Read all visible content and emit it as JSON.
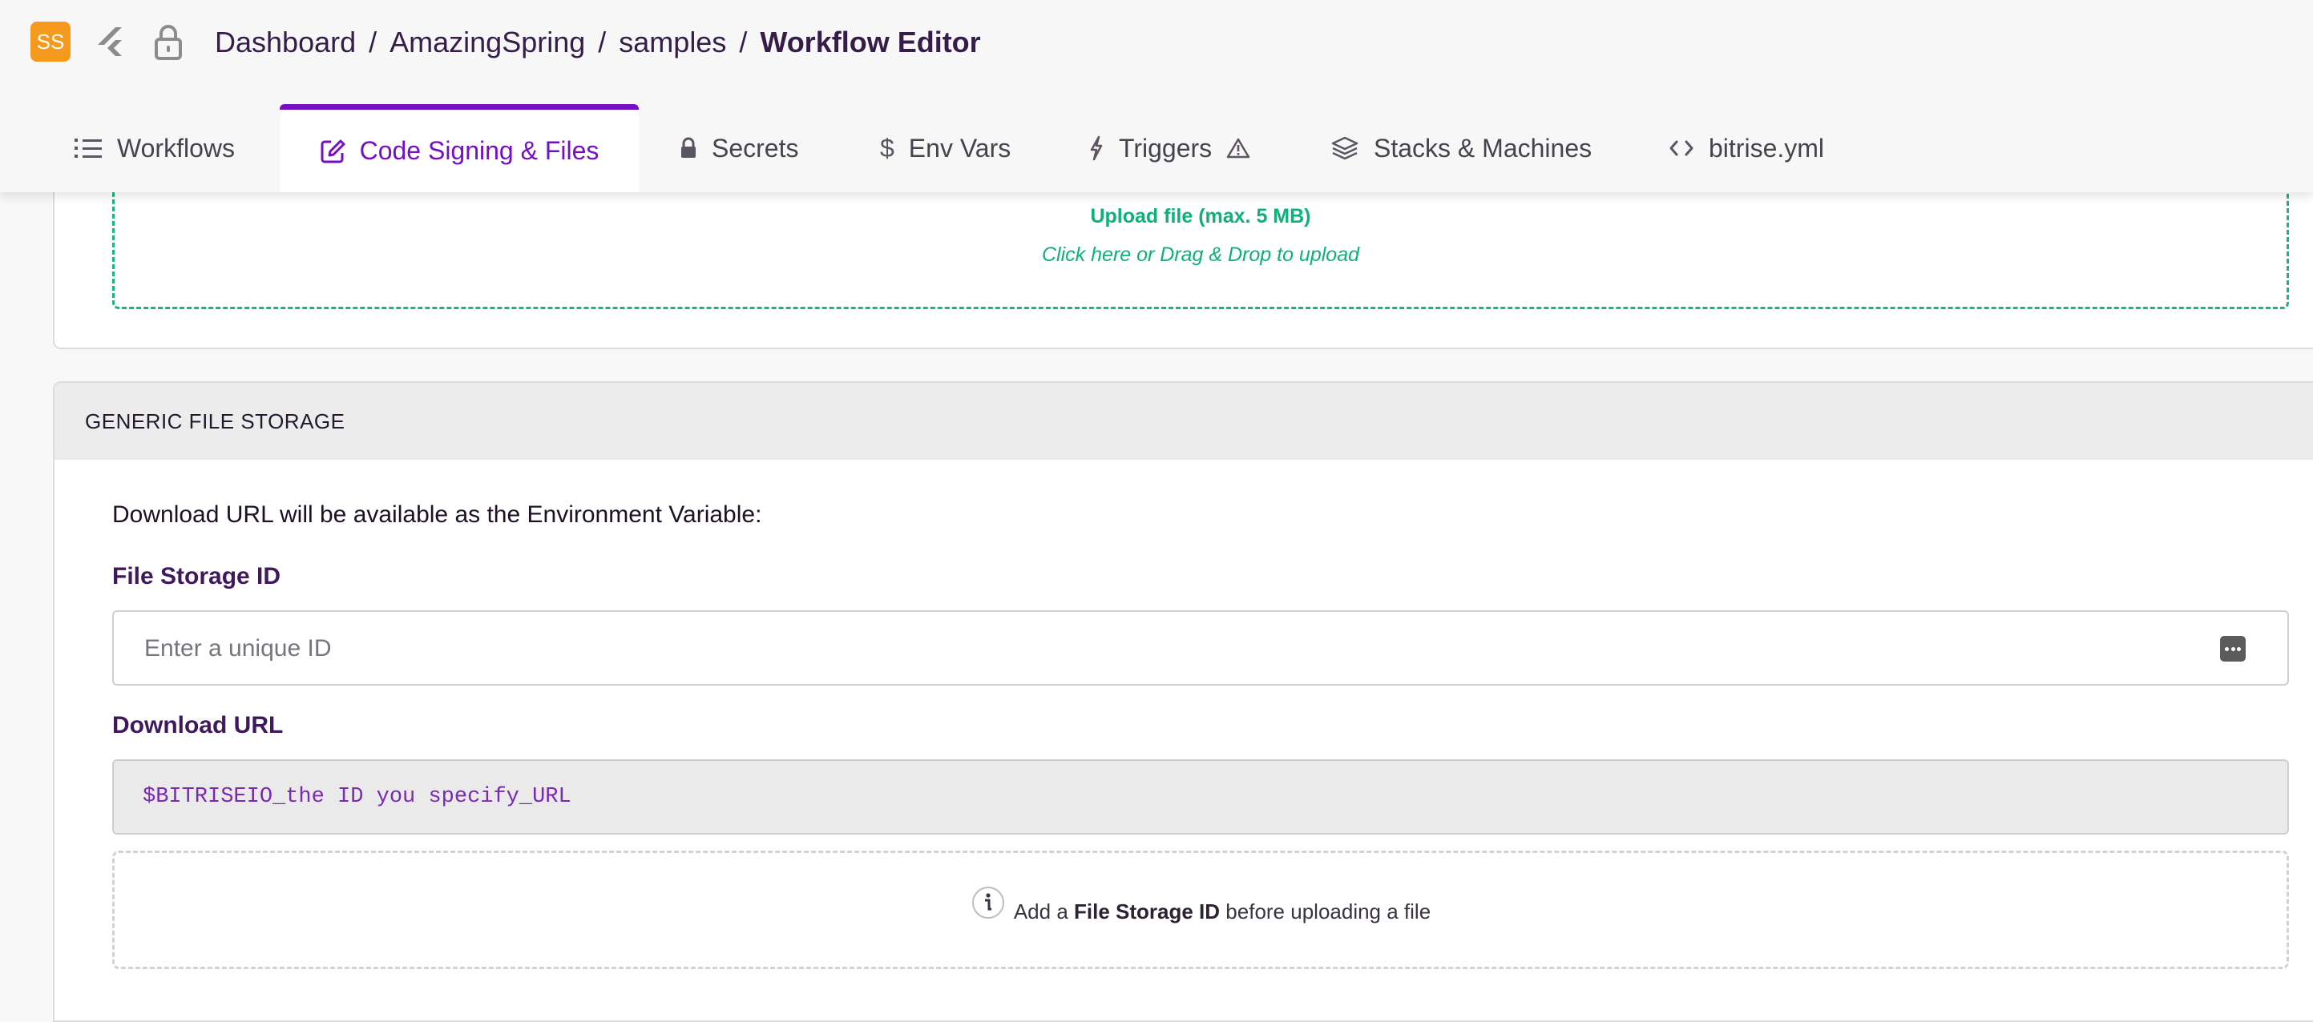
{
  "header": {
    "avatar_initials": "SS",
    "breadcrumb": {
      "items": [
        "Dashboard",
        "AmazingSpring",
        "samples"
      ],
      "separator": "/",
      "current": "Workflow Editor"
    },
    "icons": [
      "flutter-icon",
      "lock-icon"
    ]
  },
  "tabs": [
    {
      "label": "Workflows",
      "icon": "list-icon",
      "active": false
    },
    {
      "label": "Code Signing & Files",
      "icon": "edit-box-icon",
      "active": true
    },
    {
      "label": "Secrets",
      "icon": "lock-icon",
      "active": false
    },
    {
      "label": "Env Vars",
      "icon": "dollar-icon",
      "active": false
    },
    {
      "label": "Triggers",
      "icon": "bolt-icon",
      "active": false,
      "warning_icon": "warning-icon"
    },
    {
      "label": "Stacks & Machines",
      "icon": "layers-icon",
      "active": false
    },
    {
      "label": "bitrise.yml",
      "icon": "code-icon",
      "active": false
    }
  ],
  "upload_zone": {
    "title": "Upload file (max. 5 MB)",
    "hint": "Click here or Drag & Drop to upload"
  },
  "generic_file_storage": {
    "section_title": "GENERIC FILE STORAGE",
    "description": "Download URL will be available as the Environment Variable:",
    "file_storage_id": {
      "label": "File Storage ID",
      "value": "",
      "placeholder": "Enter a unique ID"
    },
    "download_url": {
      "label": "Download URL",
      "value": "$BITRISEIO_the ID you specify_URL"
    },
    "info": {
      "prefix": "Add a",
      "emphasis": "File Storage ID",
      "suffix": "before uploading a file"
    }
  },
  "colors": {
    "accent": "#760fc3",
    "success": "#0db17c",
    "avatar": "#f69a1e",
    "label": "#3e1a5c"
  }
}
